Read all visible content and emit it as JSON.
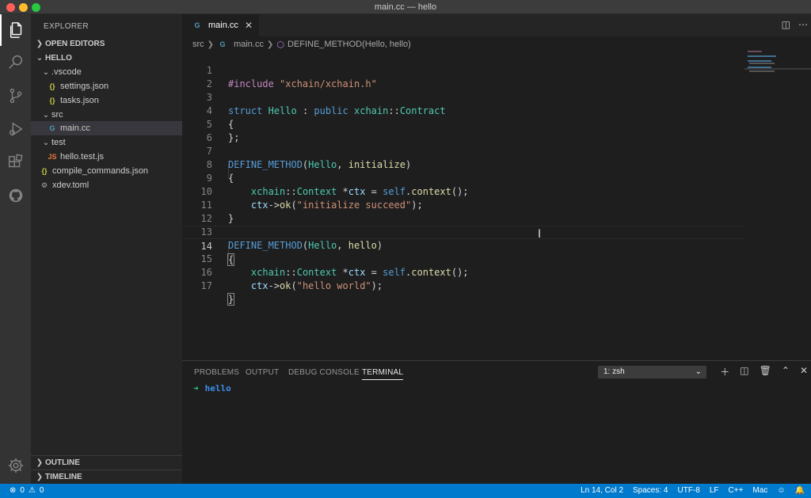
{
  "window": {
    "title": "main.cc — hello"
  },
  "explorer": {
    "title": "EXPLORER",
    "open_editors": "OPEN EDITORS",
    "project": "HELLO",
    "tree": [
      {
        "label": ".vscode",
        "type": "folder"
      },
      {
        "label": "settings.json",
        "type": "json",
        "icon": "{}"
      },
      {
        "label": "tasks.json",
        "type": "json",
        "icon": "{}"
      },
      {
        "label": "src",
        "type": "folder"
      },
      {
        "label": "main.cc",
        "type": "cc",
        "icon": "G"
      },
      {
        "label": "test",
        "type": "folder"
      },
      {
        "label": "hello.test.js",
        "type": "js",
        "icon": "JS"
      },
      {
        "label": "compile_commands.json",
        "type": "json",
        "icon": "{}"
      },
      {
        "label": "xdev.toml",
        "type": "toml",
        "icon": "⚙"
      }
    ],
    "outline": "OUTLINE",
    "timeline": "TIMELINE"
  },
  "editor": {
    "tab_label": "main.cc",
    "breadcrumb": [
      "src",
      "main.cc",
      "DEFINE_METHOD(Hello, hello)"
    ],
    "line_numbers": [
      "1",
      "2",
      "3",
      "4",
      "5",
      "6",
      "7",
      "8",
      "9",
      "10",
      "11",
      "12",
      "13",
      "14",
      "15",
      "16",
      "17"
    ],
    "tokens": {
      "include": "#include",
      "header": "\"xchain/xchain.h\"",
      "struct": "struct",
      "hello": "Hello",
      "colon": " : ",
      "public": "public",
      "ns": "xchain",
      "dcolon": "::",
      "contract": "Contract",
      "lbrace": "{",
      "rbrace_semi": "};",
      "rbrace": "}",
      "define": "DEFINE_METHOD",
      "lparen": "(",
      "comma": ", ",
      "rparen": ")",
      "initialize": "initialize",
      "hello_method": "hello",
      "context_type": "Context",
      "star": " *",
      "ctx": "ctx",
      "eq": " = ",
      "self": "self",
      "dot": ".",
      "context_fn": "context",
      "call_end": "();",
      "arrow": "->",
      "ok": "ok",
      "msg_init": "\"initialize succeed\"",
      "msg_hello": "\"hello world\"",
      "stmt_end": ");"
    }
  },
  "panel": {
    "tabs": [
      "PROBLEMS",
      "OUTPUT",
      "DEBUG CONSOLE",
      "TERMINAL"
    ],
    "active_tab": "TERMINAL",
    "terminal_select": "1: zsh",
    "prompt_arrow": "➜",
    "prompt_dir": "hello"
  },
  "status": {
    "errors": "0",
    "warnings": "0",
    "position": "Ln 14, Col 2",
    "spaces": "Spaces: 4",
    "encoding": "UTF-8",
    "eol": "LF",
    "language": "C++",
    "platform": "Mac"
  },
  "colors": {
    "statusbar": "#007acc",
    "activitybar": "#333333",
    "sidebar": "#252526",
    "editor": "#1e1e1e"
  }
}
